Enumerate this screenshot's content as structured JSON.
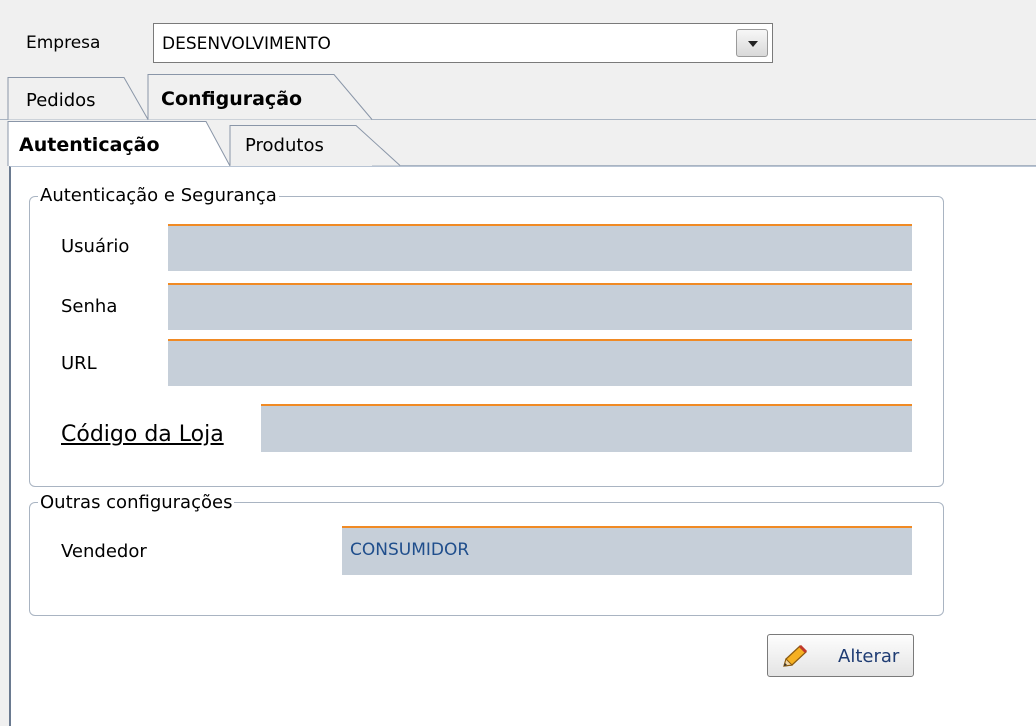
{
  "empresa": {
    "label": "Empresa",
    "selected": "DESENVOLVIMENTO"
  },
  "tabs": {
    "main": [
      {
        "label": "Pedidos"
      },
      {
        "label": "Configuração"
      }
    ],
    "sub": [
      {
        "label": "Autenticação"
      },
      {
        "label": "Produtos"
      }
    ]
  },
  "group_auth": {
    "title": "Autenticação e Segurança",
    "usuario_label": "Usuário",
    "usuario_value": "",
    "senha_label": "Senha",
    "senha_value": "",
    "url_label": "URL",
    "url_value": "",
    "codigo_label": "Código da Loja",
    "codigo_value": ""
  },
  "group_other": {
    "title": "Outras configurações",
    "vendedor_label": "Vendedor",
    "vendedor_value": "CONSUMIDOR"
  },
  "buttons": {
    "alterar": "Alterar"
  },
  "colors": {
    "field_bg": "#c6cfd9",
    "field_accent": "#f08a24",
    "button_text": "#1f3c73"
  }
}
